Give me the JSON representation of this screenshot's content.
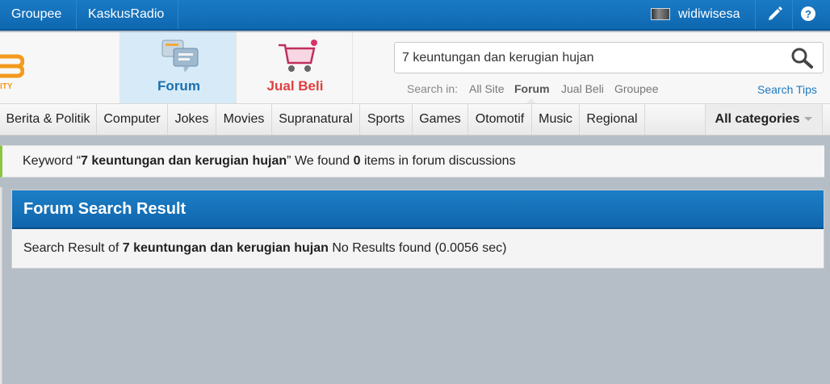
{
  "topbar": {
    "links": [
      "Groupee",
      "KaskusRadio"
    ],
    "username": "widiwisesa"
  },
  "header": {
    "logo_sub": "ITY",
    "nav": [
      {
        "label": "Forum",
        "icon": "forum-icon"
      },
      {
        "label": "Jual Beli",
        "icon": "shopping-cart-icon"
      }
    ],
    "search": {
      "value": "7 keuntungan dan kerugian hujan",
      "search_in_label": "Search in:",
      "options": [
        "All Site",
        "Forum",
        "Jual Beli",
        "Groupee"
      ],
      "selected": "Forum",
      "tips": "Search Tips"
    }
  },
  "categories": [
    "Berita & Politik",
    "Computer",
    "Jokes",
    "Movies",
    "Supranatural",
    "Sports",
    "Games",
    "Otomotif",
    "Music",
    "Regional"
  ],
  "all_categories": "All categories",
  "notice": {
    "prefix": "Keyword “",
    "keyword": "7 keuntungan dan kerugian hujan",
    "middle": "” We found ",
    "count": "0",
    "suffix": " items in forum discussions"
  },
  "result": {
    "title": "Forum Search Result",
    "prefix": "Search Result of ",
    "keyword": "7 keuntungan dan kerugian hujan",
    "suffix": " No Results found (0.0056 sec)"
  },
  "colors": {
    "topbar": "#1a7ac5",
    "accent_green": "#8cc63f",
    "forum_label": "#1b6fae",
    "jualbeli_label": "#e04040"
  }
}
